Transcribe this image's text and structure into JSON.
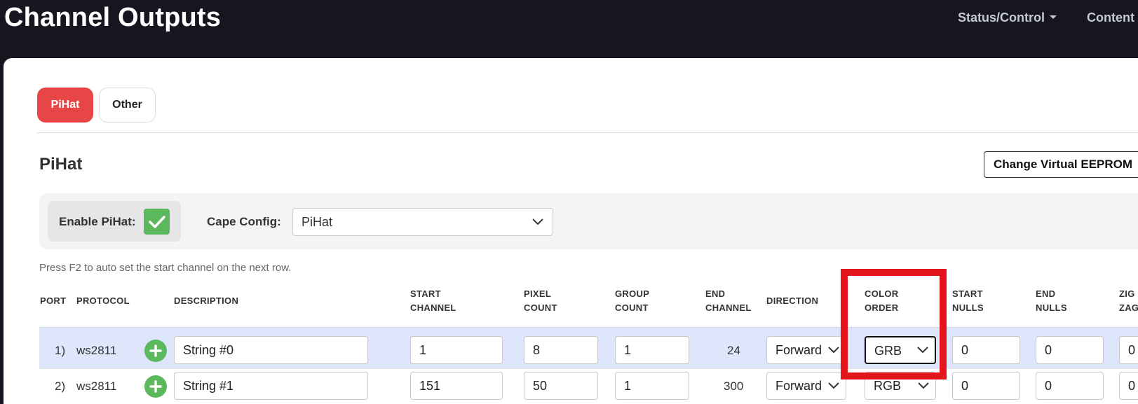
{
  "header": {
    "title": "Channel Outputs",
    "nav": {
      "status": "Status/Control",
      "content": "Content"
    }
  },
  "tabs": [
    {
      "label": "PiHat",
      "active": true
    },
    {
      "label": "Other",
      "active": false
    }
  ],
  "section": {
    "title": "PiHat",
    "eeprom_button": "Change Virtual EEPROM"
  },
  "config": {
    "enable_label": "Enable PiHat:",
    "enable_checked": true,
    "cape_label": "Cape Config:",
    "cape_value": "PiHat"
  },
  "hint": "Press F2 to auto set the start channel on the next row.",
  "table": {
    "headers": {
      "port": "PORT",
      "protocol": "PROTOCOL",
      "description": "DESCRIPTION",
      "start_channel_1": "START",
      "start_channel_2": "CHANNEL",
      "pixel_count_1": "PIXEL",
      "pixel_count_2": "COUNT",
      "group_count_1": "GROUP",
      "group_count_2": "COUNT",
      "end_channel_1": "END",
      "end_channel_2": "CHANNEL",
      "direction": "DIRECTION",
      "color_order_1": "COLOR",
      "color_order_2": "ORDER",
      "start_nulls_1": "START",
      "start_nulls_2": "NULLS",
      "end_nulls_1": "END",
      "end_nulls_2": "NULLS",
      "zigzag_1": "ZIG",
      "zigzag_2": "ZAG"
    },
    "rows": [
      {
        "port": "1)",
        "protocol": "ws2811",
        "description": "String #0",
        "start_channel": "1",
        "pixel_count": "8",
        "group_count": "1",
        "end_channel": "24",
        "direction": "Forward",
        "color_order": "GRB",
        "start_nulls": "0",
        "end_nulls": "0",
        "zigzag": "0"
      },
      {
        "port": "2)",
        "protocol": "ws2811",
        "description": "String #1",
        "start_channel": "151",
        "pixel_count": "50",
        "group_count": "1",
        "end_channel": "300",
        "direction": "Forward",
        "color_order": "RGB",
        "start_nulls": "0",
        "end_nulls": "0",
        "zigzag": "0"
      }
    ]
  },
  "colors": {
    "accent": "#e84646",
    "success": "#5cb85c",
    "highlight": "#e3141c",
    "row_selected": "#dde6fb",
    "header_bg": "#15161f"
  }
}
